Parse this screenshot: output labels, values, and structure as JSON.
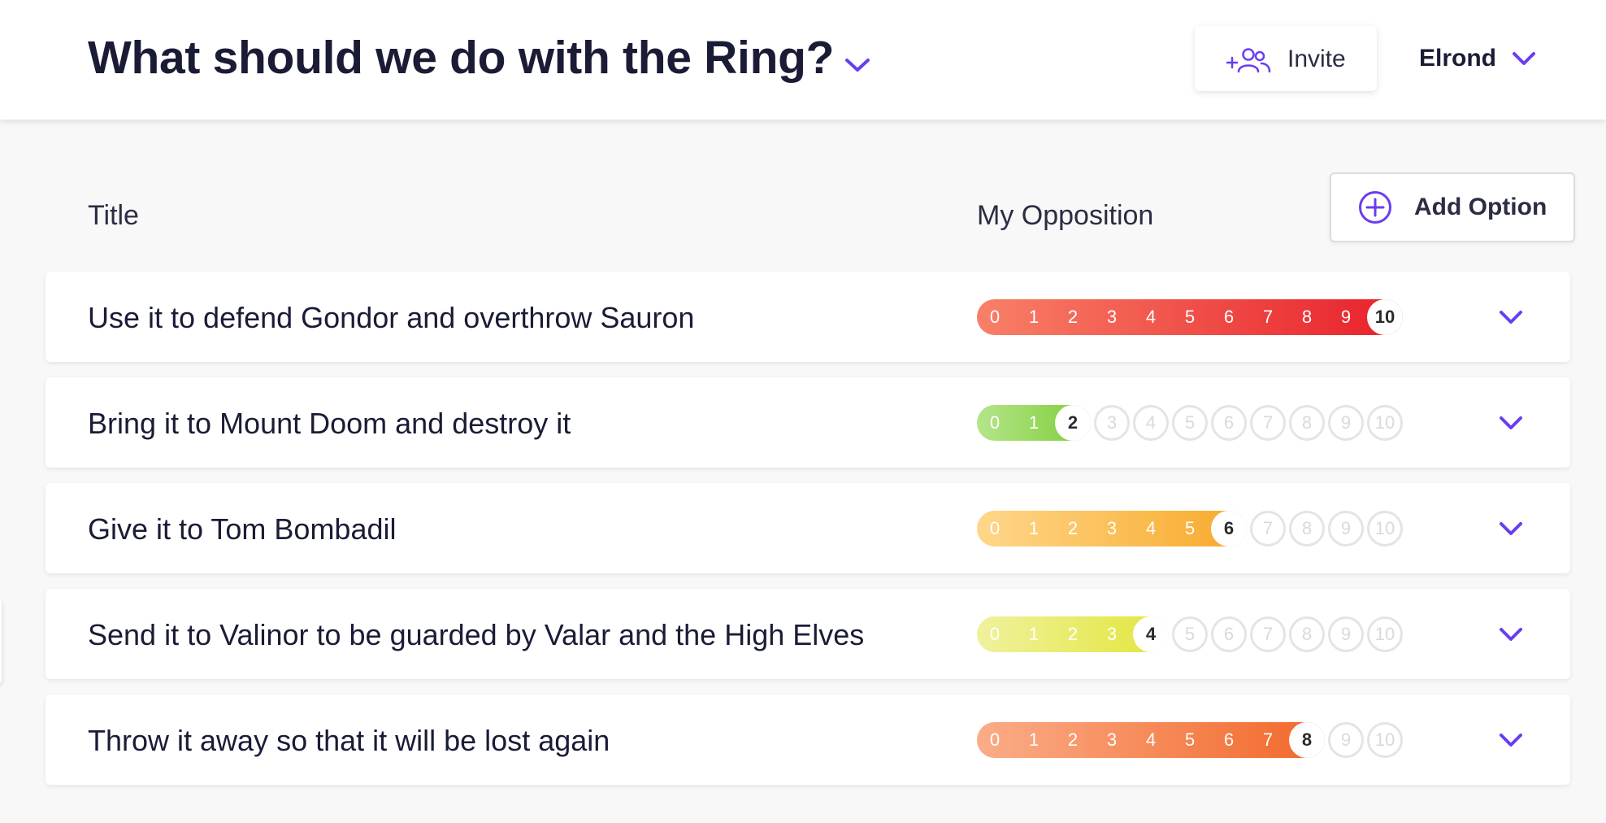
{
  "header": {
    "title": "What should we do with the Ring?",
    "invite_label": "Invite",
    "user_name": "Elrond"
  },
  "columns": {
    "title": "Title",
    "opposition": "My Opposition"
  },
  "add_option_label": "Add Option",
  "accent_color": "#6a3df0",
  "scale_labels": [
    "0",
    "1",
    "2",
    "3",
    "4",
    "5",
    "6",
    "7",
    "8",
    "9",
    "10"
  ],
  "options": [
    {
      "title": "Use it to defend Gondor and overthrow Sauron",
      "opposition": 10,
      "gradient": [
        "#f88068",
        "#e8202a"
      ]
    },
    {
      "title": "Bring it to Mount Doom and destroy it",
      "opposition": 2,
      "gradient": [
        "#b5e58a",
        "#7dcd36"
      ]
    },
    {
      "title": "Give it to Tom Bombadil",
      "opposition": 6,
      "gradient": [
        "#ffd78a",
        "#f7a92a"
      ]
    },
    {
      "title": "Send it to Valinor to be guarded by Valar and the High Elves",
      "opposition": 4,
      "gradient": [
        "#f0f19e",
        "#e2e63a"
      ]
    },
    {
      "title": "Throw it away so that it will be lost again",
      "opposition": 8,
      "gradient": [
        "#fbac88",
        "#f2682a"
      ]
    }
  ]
}
